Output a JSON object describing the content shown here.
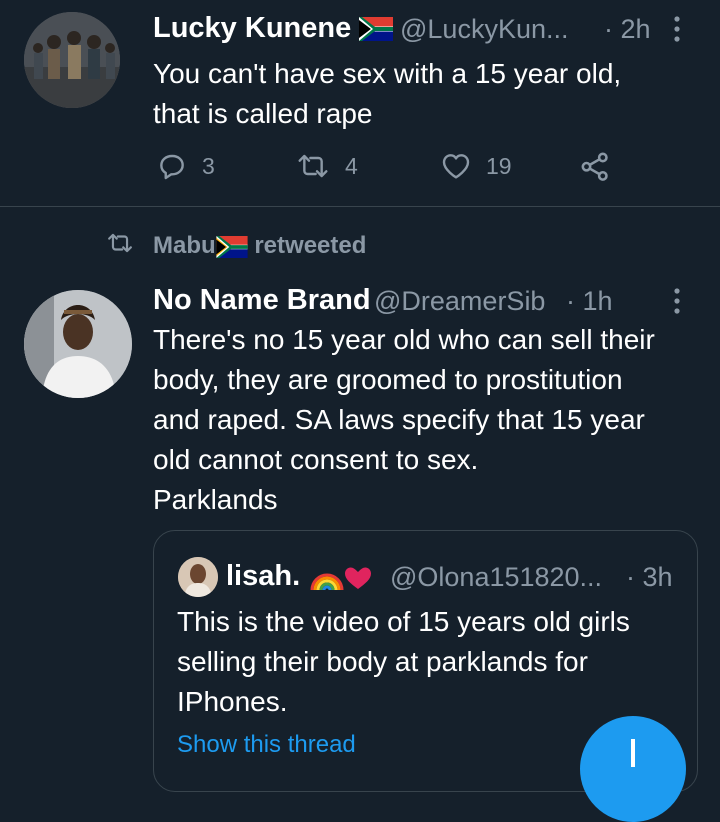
{
  "tweet1": {
    "name": "Lucky Kunene",
    "handle": "@LuckyKun...",
    "time": "· 2h",
    "text_lines": [
      "You can't have sex with a 15 year old,",
      "that is called rape"
    ],
    "replies": "3",
    "retweets": "4",
    "likes": "19"
  },
  "retweet_banner": {
    "user": "Mabu",
    "suffix": "retweeted"
  },
  "tweet2": {
    "name": "No Name Brand",
    "handle": "@DreamerSib",
    "time": "· 1h",
    "text_lines": [
      "There's no 15 year old who can sell their",
      "body, they are groomed to prostitution",
      "and raped. SA laws specify that 15 year",
      "old cannot consent to sex.",
      "Parklands"
    ]
  },
  "quoted": {
    "name": "lisah.",
    "handle": "@Olona151820...",
    "time": "· 3h",
    "text_lines": [
      "This is the video of 15 years old girls",
      "selling their body at parklands for",
      "IPhones."
    ],
    "show_thread": "Show this thread"
  },
  "fab": {
    "icon": "plus-icon"
  },
  "colors": {
    "background": "#15202b",
    "secondary_text": "#8b98a5",
    "link": "#1d9bf0",
    "border": "#38444d"
  }
}
